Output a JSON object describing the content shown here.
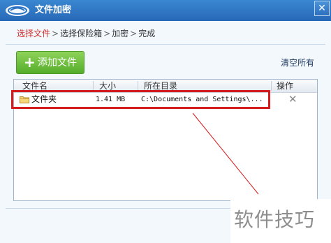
{
  "window": {
    "title": "文件加密",
    "close_symbol": "✕"
  },
  "breadcrumb": {
    "steps": [
      "选择文件",
      "选择保险箱",
      "加密",
      "完成"
    ],
    "separator": ">"
  },
  "toolbar": {
    "add_label": "添加文件",
    "add_icon": "+",
    "clear_label": "清空所有"
  },
  "table": {
    "headers": [
      "文件名",
      "大小",
      "所在目录",
      "操作"
    ],
    "rows": [
      {
        "name": "文件夹",
        "size": "1.41 MB",
        "directory": "C:\\Documents and Settings\\...",
        "action_symbol": "✕"
      }
    ]
  },
  "watermark": "软件技巧",
  "colors": {
    "titlebar": "#2f78c6",
    "active_step": "#d0302b",
    "add_button": "#6cc23d",
    "highlight": "#d51c1c"
  }
}
